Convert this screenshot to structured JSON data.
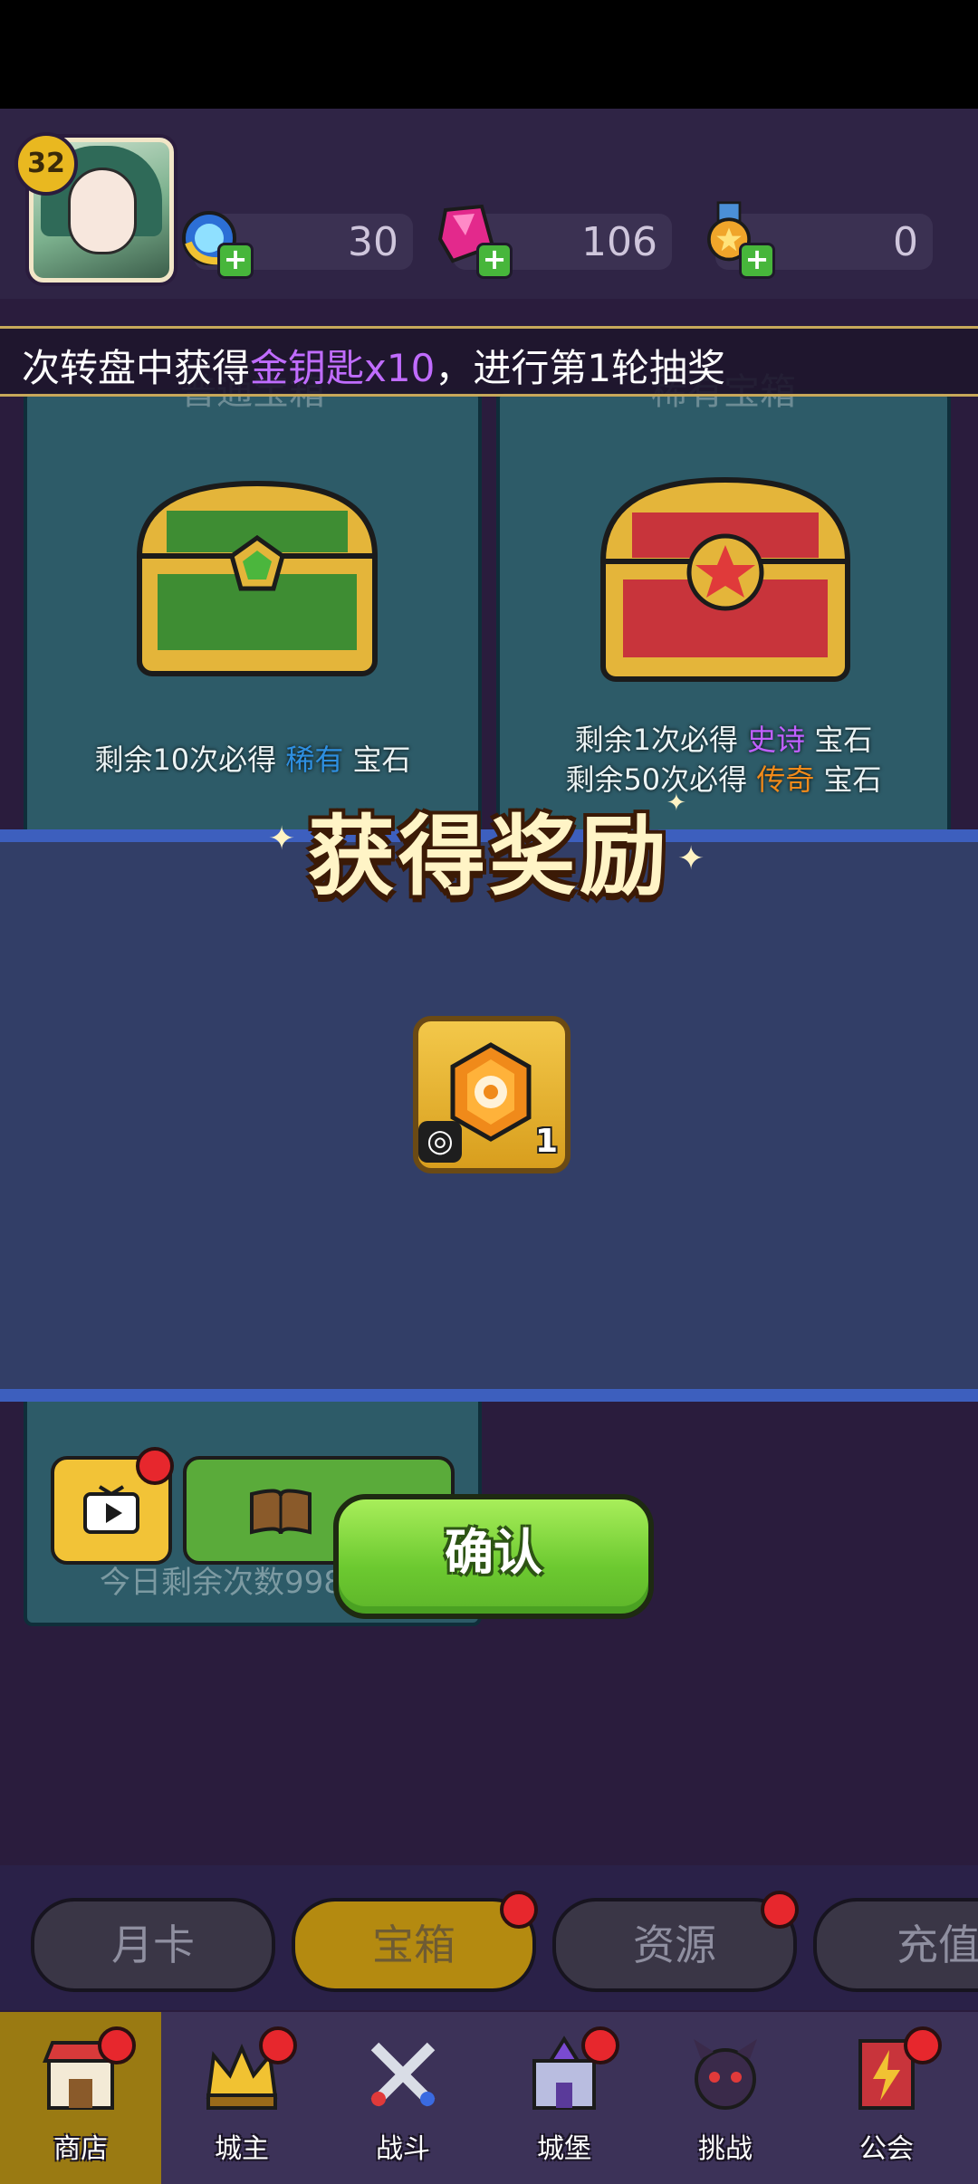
{
  "player": {
    "level": "32"
  },
  "resources": [
    {
      "name": "key",
      "value": "30"
    },
    {
      "name": "gem",
      "value": "106"
    },
    {
      "name": "medal",
      "value": "0"
    }
  ],
  "marquee": {
    "prefix": "次转盘中获得",
    "highlight": "金钥匙x10",
    "suffix": "，进行第1轮抽奖"
  },
  "chests": {
    "left": {
      "title": "普通宝箱",
      "line1_prefix": "剩余10次必得",
      "line1_rarity": "稀有",
      "line1_suffix": "宝石"
    },
    "right": {
      "title": "稀有宝箱",
      "line1_prefix": "剩余1次必得",
      "line1_rarity": "史诗",
      "line1_suffix": "宝石",
      "line2_prefix": "剩余50次必得",
      "line2_rarity": "传奇",
      "line2_suffix": "宝石"
    }
  },
  "reward_dialog": {
    "title": "获得奖励",
    "item": {
      "icon": "gem-icon",
      "badge_icon": "ring-icon",
      "count": "1"
    },
    "confirm_label": "确认"
  },
  "lower_card": {
    "remaining": "今日剩余次数998"
  },
  "tabs": [
    {
      "label": "月卡",
      "active": false,
      "badge": false
    },
    {
      "label": "宝箱",
      "active": true,
      "badge": true
    },
    {
      "label": "资源",
      "active": false,
      "badge": true
    },
    {
      "label": "充值",
      "active": false,
      "badge": false
    }
  ],
  "nav": [
    {
      "label": "商店",
      "active": true
    },
    {
      "label": "城主",
      "active": false
    },
    {
      "label": "战斗",
      "active": false
    },
    {
      "label": "城堡",
      "active": false
    },
    {
      "label": "挑战",
      "active": false
    },
    {
      "label": "公会",
      "active": false
    }
  ],
  "colors": {
    "accent_green": "#6cc930",
    "panel_blue": "#323e67",
    "rare": "#2e8fe0",
    "epic": "#c060ff",
    "legend": "#f08a1a"
  }
}
